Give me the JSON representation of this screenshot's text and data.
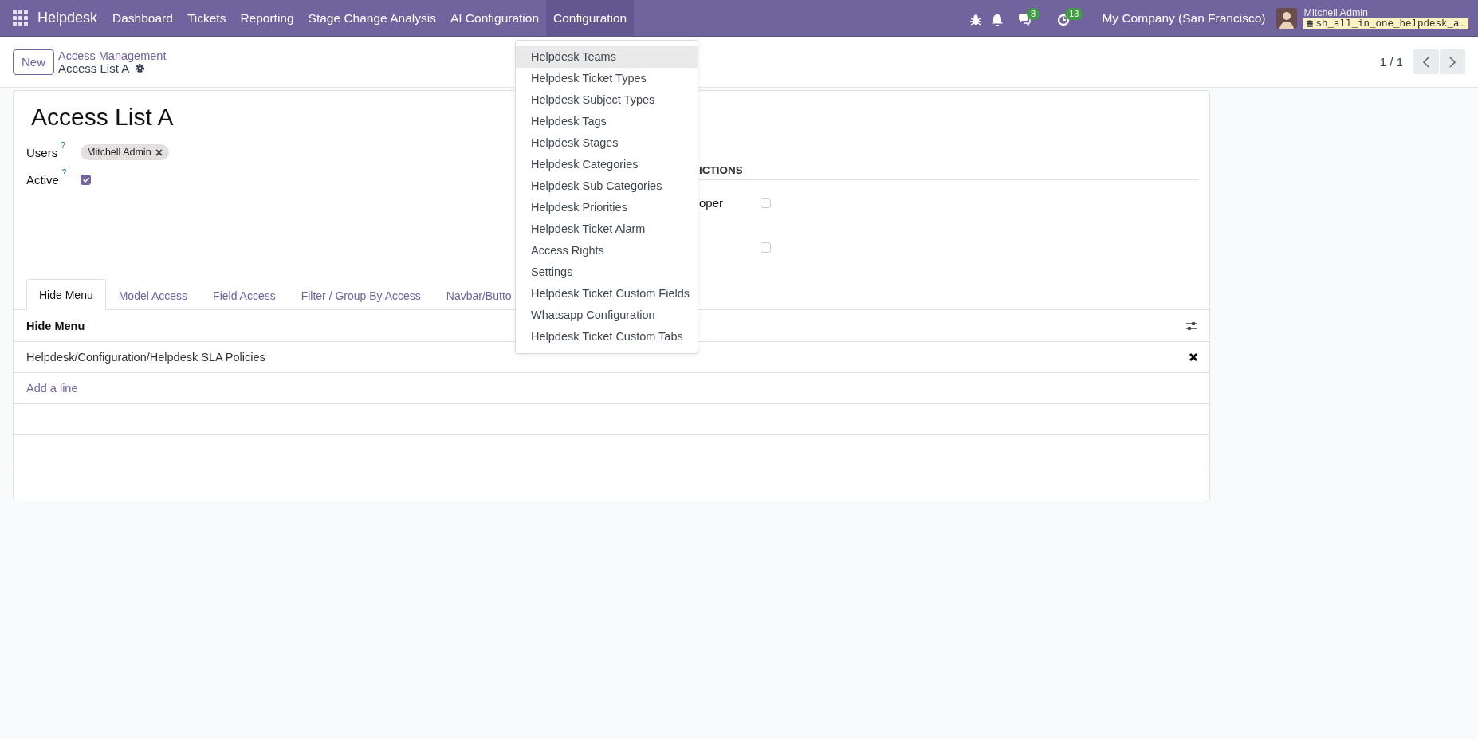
{
  "navbar": {
    "app_name": "Helpdesk",
    "menu": [
      {
        "label": "Dashboard",
        "selected": false
      },
      {
        "label": "Tickets",
        "selected": false
      },
      {
        "label": "Reporting",
        "selected": false
      },
      {
        "label": "Stage Change Analysis",
        "selected": false
      },
      {
        "label": "AI Configuration",
        "selected": false
      },
      {
        "label": "Configuration",
        "selected": true
      }
    ],
    "chat_count": "8",
    "activity_count": "13",
    "company": "My Company (San Francisco)",
    "user_name": "Mitchell Admin",
    "database": "sh_all_in_one_helpdesk_a…"
  },
  "control_panel": {
    "new_button": "New",
    "breadcrumb_parent": "Access Management",
    "breadcrumb_current": "Access List A",
    "pager": "1 / 1"
  },
  "form": {
    "title": "Access List A",
    "fields": [
      {
        "label": "Users",
        "help": "?",
        "kind": "tags",
        "tags": [
          "Mitchell Admin"
        ]
      },
      {
        "label": "Active",
        "help": "?",
        "kind": "checkbox",
        "checked": true
      }
    ],
    "restrictions": {
      "heading": "ICTIONS",
      "rows": [
        {
          "label": "oper",
          "checked": false
        },
        {
          "checked": false
        }
      ]
    },
    "tabs": [
      {
        "label": "Hide Menu",
        "selected": true
      },
      {
        "label": "Model Access",
        "selected": false
      },
      {
        "label": "Field Access",
        "selected": false
      },
      {
        "label": "Filter / Group By Access",
        "selected": false
      },
      {
        "label": "Navbar/Butto",
        "selected": false
      }
    ],
    "hide_menu_table": {
      "column": "Hide Menu",
      "rows": [
        "Helpdesk/Configuration/Helpdesk SLA Policies"
      ],
      "add_line": "Add a line"
    }
  },
  "dropdown": {
    "items": [
      {
        "label": "Helpdesk Teams",
        "selected": true
      },
      {
        "label": "Helpdesk Ticket Types",
        "selected": false
      },
      {
        "label": "Helpdesk Subject Types",
        "selected": false
      },
      {
        "label": "Helpdesk Tags",
        "selected": false
      },
      {
        "label": "Helpdesk Stages",
        "selected": false
      },
      {
        "label": "Helpdesk Categories",
        "selected": false
      },
      {
        "label": "Helpdesk Sub Categories",
        "selected": false
      },
      {
        "label": "Helpdesk Priorities",
        "selected": false
      },
      {
        "label": "Helpdesk Ticket Alarm",
        "selected": false
      },
      {
        "label": "Access Rights",
        "selected": false
      },
      {
        "label": "Settings",
        "selected": false
      },
      {
        "label": "Helpdesk Ticket Custom Fields",
        "selected": false
      },
      {
        "label": "Whatsapp Configuration",
        "selected": false
      },
      {
        "label": "Helpdesk Ticket Custom Tabs",
        "selected": false
      }
    ]
  }
}
